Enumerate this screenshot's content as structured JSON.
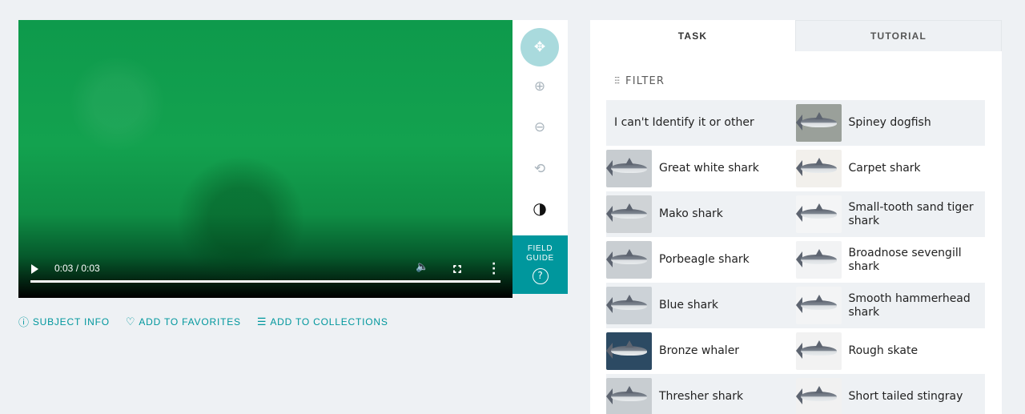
{
  "video": {
    "time": "0:03 / 0:03",
    "progress": 1.0
  },
  "toolbar": {
    "tools": [
      {
        "name": "move-icon",
        "glyph": "✥"
      },
      {
        "name": "zoom-in-icon",
        "glyph": "⊕"
      },
      {
        "name": "zoom-out-icon",
        "glyph": "⊖"
      },
      {
        "name": "rotate-icon",
        "glyph": "⟲"
      },
      {
        "name": "invert-icon",
        "glyph": "◑"
      }
    ],
    "field_guide": "FIELD GUIDE",
    "help_glyph": "?"
  },
  "meta_links": {
    "subject_info": "SUBJECT INFO",
    "add_to_favorites": "ADD TO FAVORITES",
    "add_to_collections": "ADD TO COLLECTIONS"
  },
  "tabs": {
    "task": "TASK",
    "tutorial": "TUTORIAL"
  },
  "filter": {
    "label": "FILTER"
  },
  "choices": [
    [
      "I can't Identify it or other",
      "Spiney dogfish"
    ],
    [
      "Great white shark",
      "Carpet shark"
    ],
    [
      "Mako shark",
      "Small-tooth sand tiger shark"
    ],
    [
      "Porbeagle shark",
      "Broadnose sevengill shark"
    ],
    [
      "Blue shark",
      "Smooth hammerhead shark"
    ],
    [
      "Bronze whaler",
      "Rough skate"
    ],
    [
      "Thresher shark",
      "Short tailed stingray"
    ]
  ],
  "colors": {
    "accent": "#00979d",
    "row_shade": "#eef1f4"
  }
}
